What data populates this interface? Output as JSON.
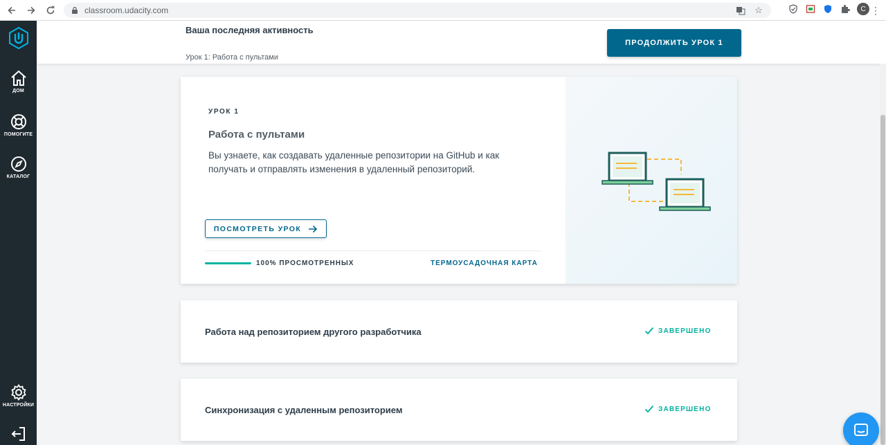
{
  "browser": {
    "url": "classroom.udacity.com",
    "profile_initial": "C",
    "menu": "⋮"
  },
  "sidebar": {
    "items": [
      {
        "label": "ДОМ",
        "icon": "home-icon"
      },
      {
        "label": "ПОМОГИТЕ",
        "icon": "help-lifebuoy-icon"
      },
      {
        "label": "КАТАЛОГ",
        "icon": "compass-icon"
      },
      {
        "label": "НАСТРОЙКИ",
        "icon": "gear-icon"
      }
    ],
    "logout_icon": "logout-icon"
  },
  "activity": {
    "title": "Ваша последняя активность",
    "subtitle": "Урок 1: Работа с пультами",
    "continue_label": "ПРОДОЛЖИТЬ УРОК 1"
  },
  "lesson": {
    "kicker": "УРОК 1",
    "title": "Работа с пультами",
    "description": "Вы узнаете, как создавать удаленные репозитории на GitHub и как получать и отправлять изменения в удаленный репозиторий.",
    "view_label": "ПОСМОТРЕТЬ УРОК",
    "progress_percent": 100,
    "progress_text": "100% ПРОСМОТРЕННЫХ",
    "map_link": "ТЕРМОУСАДОЧНАЯ КАРТА"
  },
  "concepts": [
    {
      "title": "Работа над репозиторием другого разработчика",
      "status": "ЗАВЕРШЕНО"
    },
    {
      "title": "Синхронизация с удаленным репозиторием",
      "status": "ЗАВЕРШЕНО"
    }
  ],
  "colors": {
    "brand": "#02678d",
    "success": "#02b3a0",
    "sidebar": "#1f2930",
    "chat": "#2196f3"
  }
}
